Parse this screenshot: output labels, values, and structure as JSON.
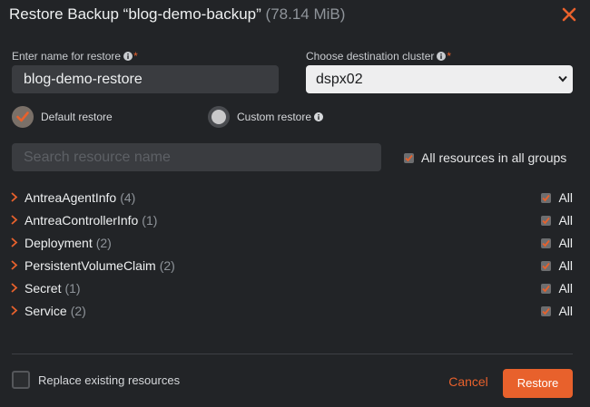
{
  "dialog": {
    "title": "Restore Backup “blog-demo-backup”",
    "size": "(78.14 MiB)",
    "close_icon": "close-icon"
  },
  "form": {
    "name_label": "Enter name for restore",
    "name_value": "blog-demo-restore",
    "cluster_label": "Choose destination cluster",
    "cluster_value": "dspx02",
    "required_mark": "*"
  },
  "restore_type": {
    "default_label": "Default restore",
    "custom_label": "Custom restore",
    "selected": "default"
  },
  "search": {
    "placeholder": "Search resource name"
  },
  "all_resources": {
    "label": "All resources in all groups",
    "checked": true
  },
  "resources": [
    {
      "name": "AntreaAgentInfo",
      "count": "(4)",
      "all_label": "All",
      "checked": true
    },
    {
      "name": "AntreaControllerInfo",
      "count": "(1)",
      "all_label": "All",
      "checked": true
    },
    {
      "name": "Deployment",
      "count": "(2)",
      "all_label": "All",
      "checked": true
    },
    {
      "name": "PersistentVolumeClaim",
      "count": "(2)",
      "all_label": "All",
      "checked": true
    },
    {
      "name": "Secret",
      "count": "(1)",
      "all_label": "All",
      "checked": true
    },
    {
      "name": "Service",
      "count": "(2)",
      "all_label": "All",
      "checked": true
    }
  ],
  "footer": {
    "replace_label": "Replace existing resources",
    "replace_checked": false,
    "cancel_label": "Cancel",
    "restore_label": "Restore"
  },
  "colors": {
    "accent": "#e8612c",
    "background": "#222427",
    "input_bg": "#3a3c40"
  }
}
